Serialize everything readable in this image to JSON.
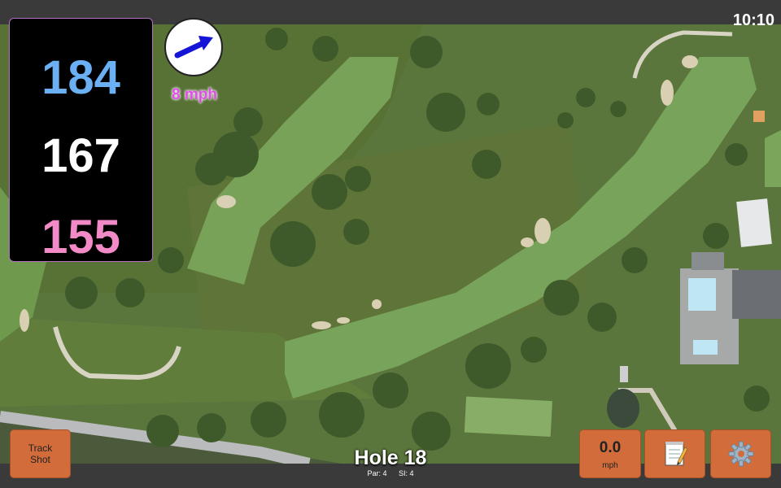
{
  "status": {
    "time": "10:10"
  },
  "yardage": {
    "back": "184",
    "middle": "167",
    "front": "155"
  },
  "wind": {
    "speed_label": "8 mph",
    "icon": "wind-arrow-icon"
  },
  "hole": {
    "title": "Hole 18",
    "par": "Par: 4",
    "stroke_index": "SI: 4"
  },
  "buttons": {
    "track_shot_line1": "Track",
    "track_shot_line2": "Shot",
    "speed_value": "0.0",
    "speed_unit": "mph",
    "notes_icon": "notepad-icon",
    "settings_icon": "gear-icon"
  },
  "colors": {
    "back_yardage": "#6ab0f2",
    "middle_yardage": "#ffffff",
    "front_yardage": "#f28ac8",
    "button": "#d26c3a",
    "wind_text": "#e04ee8"
  }
}
